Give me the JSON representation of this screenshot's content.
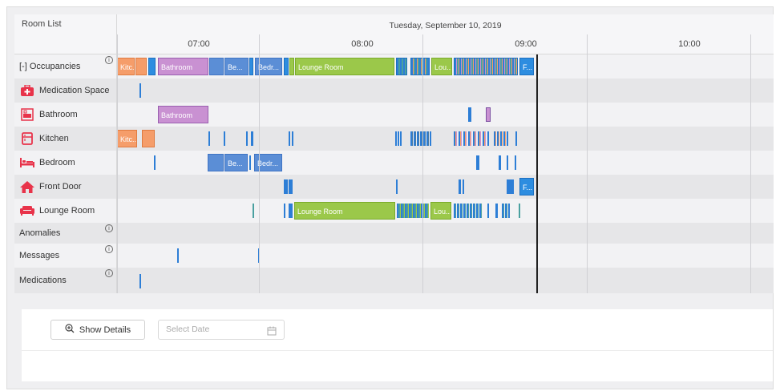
{
  "header": {
    "room_list_label": "Room List",
    "date": "Tuesday, September 10, 2019",
    "hours": [
      "07:00",
      "08:00",
      "09:00",
      "10:00"
    ]
  },
  "rows": {
    "occupancies": {
      "label": "[-] Occupancies",
      "info": "i"
    },
    "medication_space": {
      "label": "Medication Space",
      "icon": "medical-kit-icon"
    },
    "bathroom": {
      "label": "Bathroom",
      "icon": "bathtub-icon",
      "segment": "Bathroom"
    },
    "kitchen": {
      "label": "Kitchen",
      "icon": "fridge-icon",
      "segment": "Kitc..."
    },
    "bedroom": {
      "label": "Bedroom",
      "icon": "bed-icon",
      "segment_a": "Be...",
      "segment_b": "Bedr..."
    },
    "front_door": {
      "label": "Front Door",
      "icon": "house-icon",
      "segment": "F..."
    },
    "lounge_room": {
      "label": "Lounge Room",
      "icon": "sofa-icon",
      "segment_a": "Lounge Room",
      "segment_b": "Lou..."
    },
    "anomalies": {
      "label": "Anomalies",
      "info": "i"
    },
    "messages": {
      "label": "Messages",
      "info": "i"
    },
    "medications": {
      "label": "Medications",
      "info": "i"
    }
  },
  "occupancy_segments": [
    "Kitc...",
    "Bathroom",
    "Be...",
    "Bedr...",
    "Lounge Room",
    "Lou...",
    "F..."
  ],
  "controls": {
    "show_details_label": "Show Details",
    "date_placeholder": "Select Date"
  },
  "colors": {
    "bathroom": "#c991d2",
    "kitchen": "#f59d6a",
    "bedroom": "#5b8ed6",
    "lounge": "#9bc84a",
    "front_door": "#2d8de0",
    "room_icon": "#e8334a"
  }
}
